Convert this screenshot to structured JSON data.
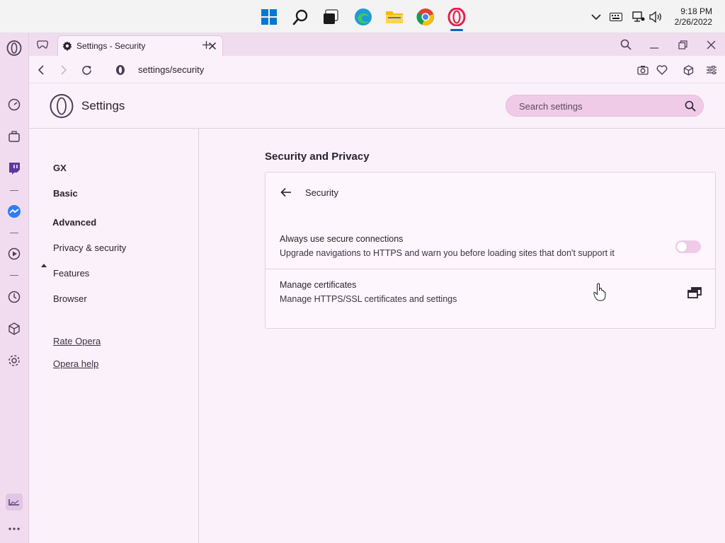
{
  "taskbar": {
    "apps": [
      "start-icon",
      "search-icon",
      "task-view-icon",
      "edge-icon",
      "file-explorer-icon",
      "chrome-icon",
      "opera-icon"
    ],
    "tray_icons": [
      "chevron-up-icon",
      "keyboard-icon",
      "network-icon",
      "volume-icon"
    ],
    "time": "9:18 PM",
    "date": "2/26/2022"
  },
  "sidebar": {
    "icons": [
      "opera-logo-icon",
      "speed-dial-icon",
      "workspaces-icon",
      "twitch-icon",
      "messenger-icon",
      "player-icon",
      "history-icon",
      "extensions-icon",
      "settings-icon",
      "pinboard-icon",
      "more-icon"
    ]
  },
  "tab": {
    "title": "Settings - Security"
  },
  "address": {
    "url": "settings/security"
  },
  "settings": {
    "title": "Settings",
    "search_placeholder": "Search settings",
    "nav": {
      "gx": "GX",
      "basic": "Basic",
      "advanced": "Advanced",
      "privacy": "Privacy & security",
      "features": "Features",
      "browser": "Browser",
      "rate": "Rate Opera",
      "help": "Opera help"
    },
    "section_title": "Security and Privacy",
    "card_title": "Security",
    "rows": [
      {
        "title": "Always use secure connections",
        "desc": "Upgrade navigations to HTTPS and warn you before loading sites that don't support it",
        "toggle_on": false
      },
      {
        "title": "Manage certificates",
        "desc": "Manage HTTPS/SSL certificates and settings"
      }
    ]
  },
  "colors": {
    "accent": "#cc3366",
    "toggle_off": "#f0cbe9",
    "sidebar_bg": "#f1dcef",
    "page_bg": "#fbf1fa"
  }
}
